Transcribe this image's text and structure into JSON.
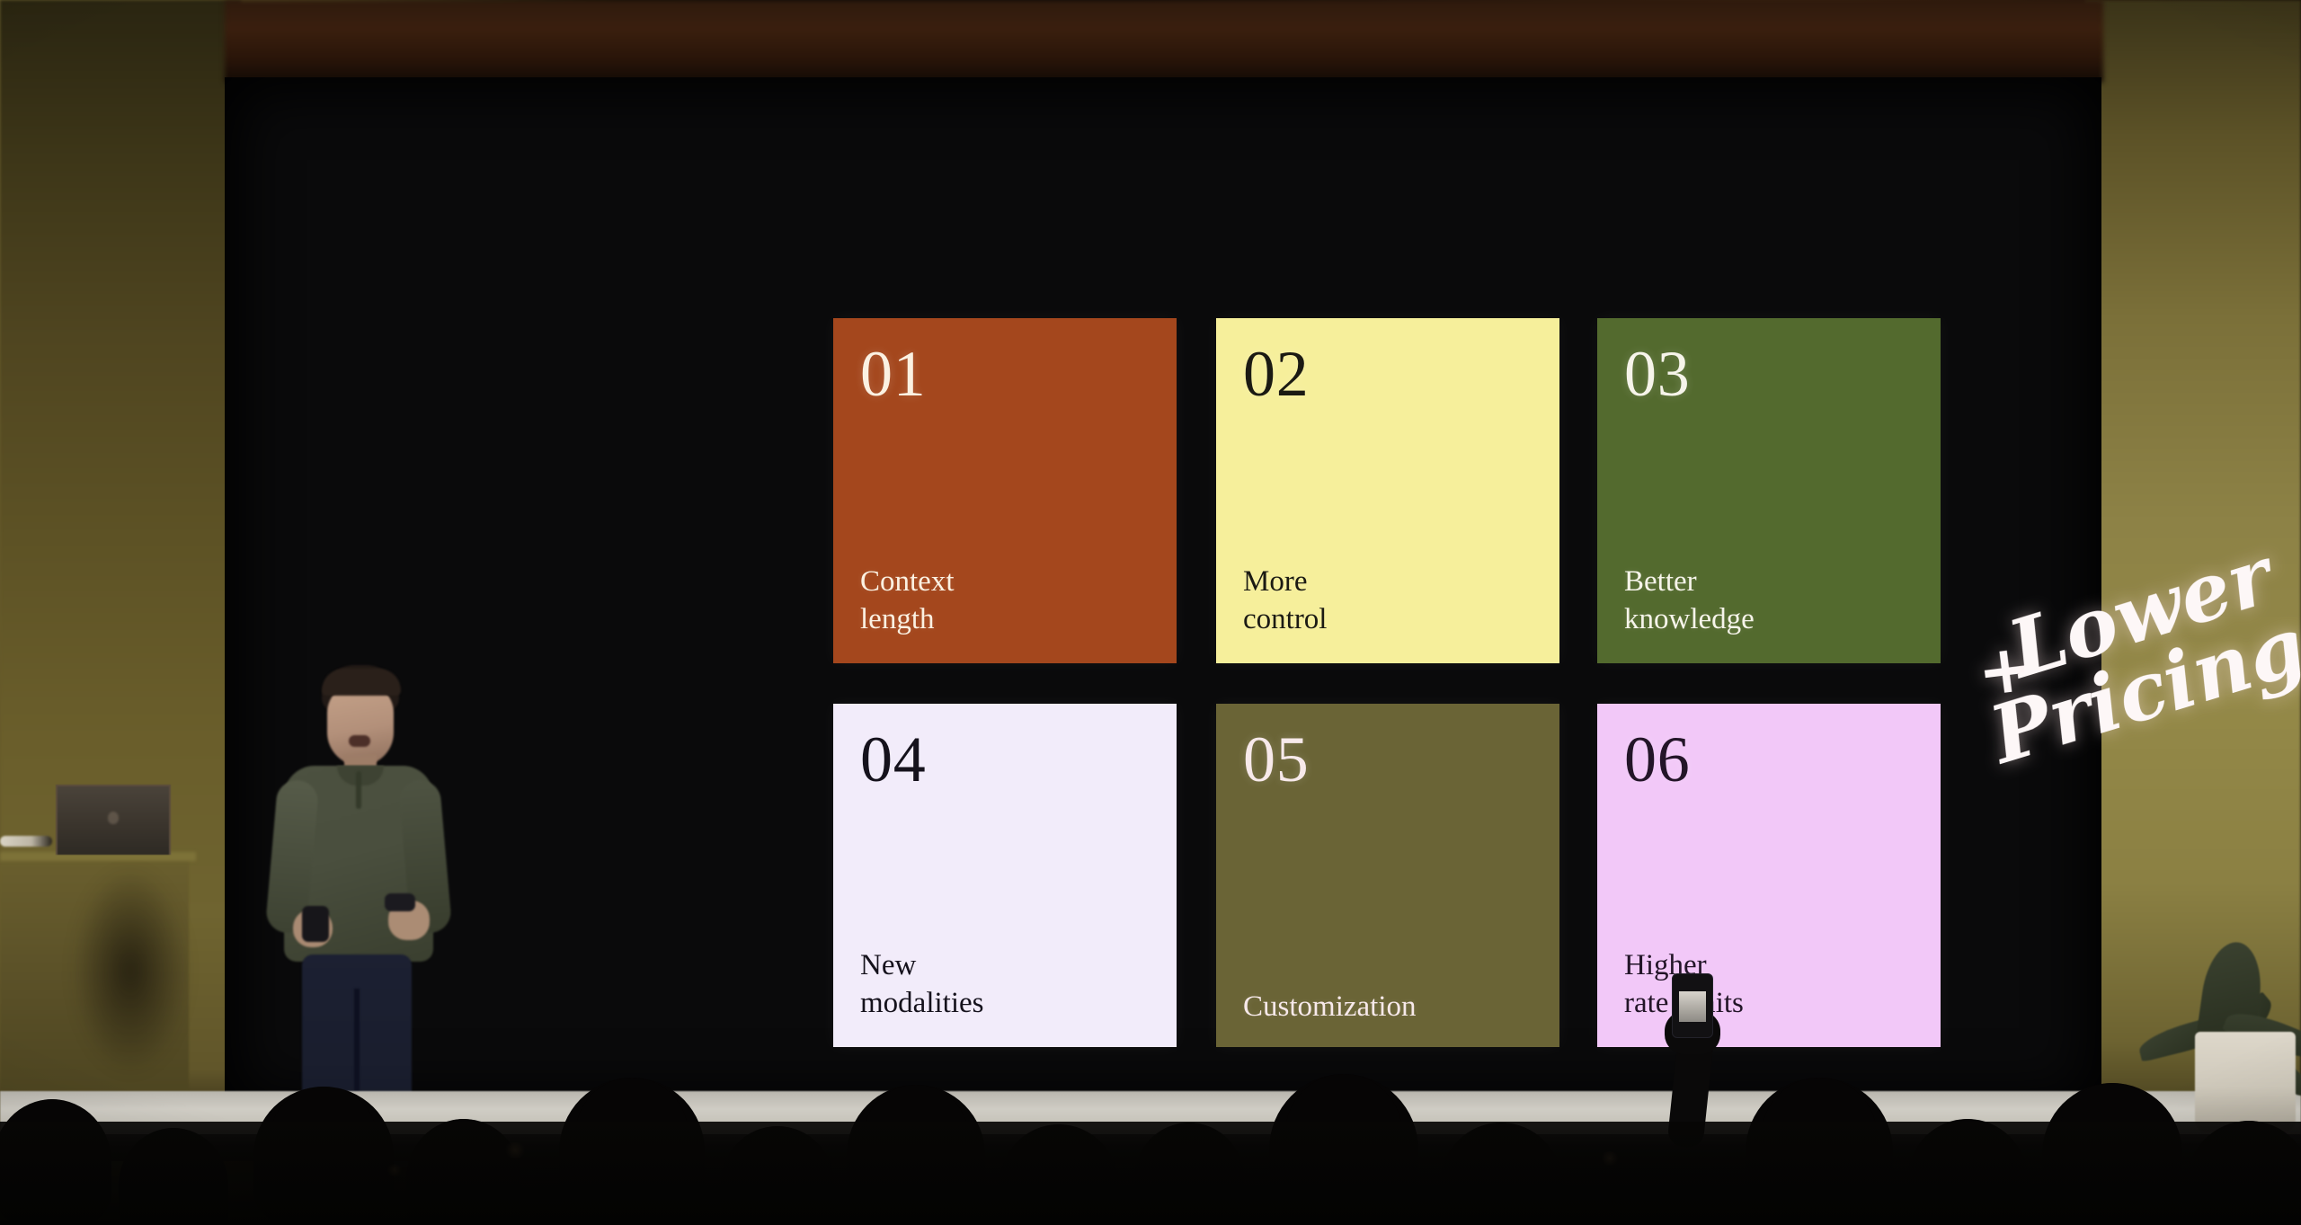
{
  "scene": {
    "venue_description": "DevDay keynote stage with large black presentation screen",
    "presenter": {
      "name_label": "presenter",
      "sweater_color": "#4c5140",
      "pants_color": "#1c2032",
      "holding": "remote-clicker"
    },
    "podium": {
      "device": "macbook-laptop",
      "laptop_state": "closed-lid"
    },
    "plant": {
      "label": "potted-plant",
      "pot_color": "#ddd7ca"
    },
    "audience": {
      "label": "audience-silhouettes",
      "recording_device": "smartphone"
    }
  },
  "slide": {
    "background_color": "#0a0a0b",
    "cards": [
      {
        "number": "01",
        "label": "Context\nlength",
        "bg": "#a4471d",
        "fg": "#fbf1e2"
      },
      {
        "number": "02",
        "label": "More\ncontrol",
        "bg": "#f6ef9b",
        "fg": "#1b1a13"
      },
      {
        "number": "03",
        "label": "Better\nknowledge",
        "bg": "#536a2e",
        "fg": "#f6f4ea"
      },
      {
        "number": "04",
        "label": "New\nmodalities",
        "bg": "#f2ecfa",
        "fg": "#15121c"
      },
      {
        "number": "05",
        "label": "Customization",
        "bg": "#6a6436",
        "fg": "#f7e9ea"
      },
      {
        "number": "06",
        "label": "Higher\nrate limits",
        "bg": "#f2c8f8",
        "fg": "#231528"
      }
    ],
    "annotation": {
      "plus_sign": "+",
      "line1": "Lower",
      "line2": "Pricing",
      "full_text": "+ Lower Pricing",
      "color": "#fdf7f7",
      "style": "handwritten-script"
    }
  }
}
